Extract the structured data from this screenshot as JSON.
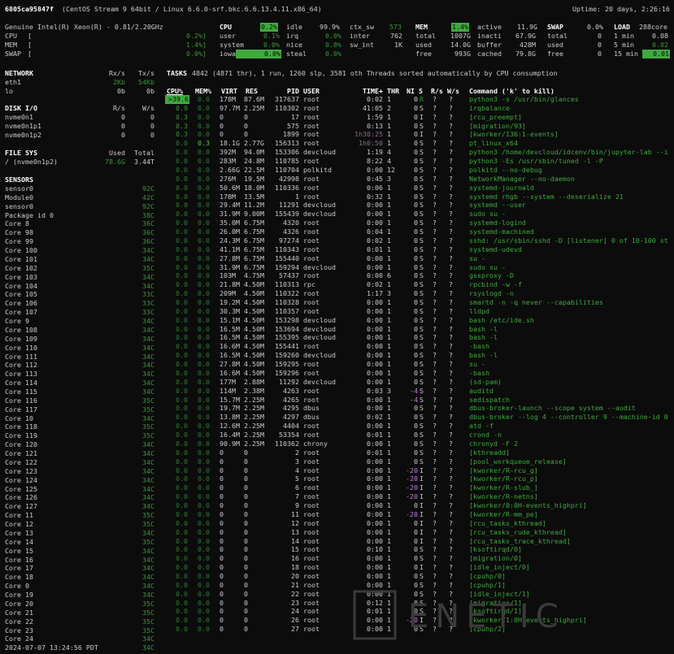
{
  "header": {
    "hostname": "6805ca95847f",
    "os": "(CentOS Stream 9 64bit / Linux 6.6.0-srf.bkc.6.6.13.4.11.x86_64)",
    "uptime": "Uptime: 20 days, 2:26:16"
  },
  "cpu_panel": {
    "model": "Genuine Intel(R) Xeon(R) - 0.81/2.20GHz",
    "bars": [
      {
        "label": "CPU",
        "bar": "[",
        "value": "0.2%]"
      },
      {
        "label": "MEM",
        "bar": "[",
        "value": "1.4%]"
      },
      {
        "label": "SWAP",
        "bar": "[",
        "value": "0.0%]"
      }
    ]
  },
  "cpu": {
    "title": "CPU",
    "total": "0.2%",
    "rows": [
      [
        "user",
        "0.1%",
        "irq",
        "0.0%",
        "inter",
        "762"
      ],
      [
        "system",
        "0.0%",
        "nice",
        "0.0%",
        "sw_int",
        "1K"
      ],
      [
        "iowait",
        "0.0%",
        "steal",
        "0.0%",
        "",
        ""
      ]
    ],
    "idle_label": "idle",
    "idle": "99.9%",
    "ctx_label": "ctx_sw",
    "ctx": "573"
  },
  "mem": {
    "title": "MEM",
    "total": "1.4%",
    "rows": [
      [
        "total",
        "1007G",
        "inacti",
        "67.9G"
      ],
      [
        "used",
        "14.0G",
        "buffer",
        "428M"
      ],
      [
        "free",
        "993G",
        "cached",
        "79.8G"
      ]
    ],
    "active_label": "active",
    "active": "11.9G"
  },
  "swap": {
    "title": "SWAP",
    "total": "0.0%",
    "rows": [
      [
        "total",
        "0"
      ],
      [
        "used",
        "0"
      ],
      [
        "free",
        "0"
      ]
    ]
  },
  "load": {
    "title": "LOAD",
    "cores": "288core",
    "rows": [
      [
        "1 min",
        "0.08"
      ],
      [
        "5 min",
        "0.02"
      ],
      [
        "15 min",
        "0.01"
      ]
    ]
  },
  "network": {
    "title": "NETWORK",
    "rx": "Rx/s",
    "tx": "Tx/s",
    "rows": [
      [
        "eth1",
        "2Kb",
        "54Kb"
      ],
      [
        "lo",
        "0b",
        "0b"
      ]
    ]
  },
  "disk": {
    "title": "DISK I/O",
    "r": "R/s",
    "w": "W/s",
    "rows": [
      [
        "nvme0n1",
        "0",
        "0"
      ],
      [
        "nvme0n1p1",
        "0",
        "0"
      ],
      [
        "nvme0n1p2",
        "0",
        "0"
      ]
    ]
  },
  "fs": {
    "title": "FILE SYS",
    "used": "Used",
    "total": "Total",
    "rows": [
      [
        "/ (nvme0n1p2)",
        "78.6G",
        "3.44T"
      ]
    ]
  },
  "sensors": {
    "title": "SENSORS",
    "rows": [
      [
        "sensor0",
        "92C"
      ],
      [
        "Module0",
        "42C"
      ],
      [
        "sensor0",
        "92C"
      ],
      [
        "Package id 0",
        "38C"
      ],
      [
        "Core 8",
        "36C"
      ],
      [
        "Core 98",
        "36C"
      ],
      [
        "Core 99",
        "36C"
      ],
      [
        "Core 100",
        "34C"
      ],
      [
        "Core 101",
        "34C"
      ],
      [
        "Core 102",
        "35C"
      ],
      [
        "Core 103",
        "34C"
      ],
      [
        "Core 104",
        "34C"
      ],
      [
        "Core 105",
        "33C"
      ],
      [
        "Core 106",
        "33C"
      ],
      [
        "Core 107",
        "33C"
      ],
      [
        "Core 9",
        "34C"
      ],
      [
        "Core 108",
        "34C"
      ],
      [
        "Core 109",
        "34C"
      ],
      [
        "Core 110",
        "34C"
      ],
      [
        "Core 111",
        "34C"
      ],
      [
        "Core 112",
        "34C"
      ],
      [
        "Core 113",
        "34C"
      ],
      [
        "Core 114",
        "34C"
      ],
      [
        "Core 115",
        "34C"
      ],
      [
        "Core 116",
        "35C"
      ],
      [
        "Core 117",
        "35C"
      ],
      [
        "Core 10",
        "34C"
      ],
      [
        "Core 118",
        "35C"
      ],
      [
        "Core 119",
        "35C"
      ],
      [
        "Core 120",
        "34C"
      ],
      [
        "Core 121",
        "34C"
      ],
      [
        "Core 122",
        "34C"
      ],
      [
        "Core 123",
        "34C"
      ],
      [
        "Core 124",
        "34C"
      ],
      [
        "Core 125",
        "34C"
      ],
      [
        "Core 126",
        "34C"
      ],
      [
        "Core 127",
        "34C"
      ],
      [
        "Core 11",
        "35C"
      ],
      [
        "Core 12",
        "35C"
      ],
      [
        "Core 13",
        "34C"
      ],
      [
        "Core 14",
        "35C"
      ],
      [
        "Core 15",
        "34C"
      ],
      [
        "Core 16",
        "34C"
      ],
      [
        "Core 17",
        "34C"
      ],
      [
        "Core 18",
        "34C"
      ],
      [
        "Core 0",
        "34C"
      ],
      [
        "Core 19",
        "34C"
      ],
      [
        "Core 20",
        "35C"
      ],
      [
        "Core 21",
        "35C"
      ],
      [
        "Core 22",
        "35C"
      ],
      [
        "Core 23",
        "35C"
      ],
      [
        "Core 24",
        "34C"
      ]
    ]
  },
  "footer": {
    "datetime": "2024-07-07 13:24:56 PDT",
    "last": "34C"
  },
  "tasks": {
    "label": "TASKS",
    "summary": "4842 (4871 thr), 1 run, 1260 slp, 3581 oth Threads sorted automatically by CPU consumption"
  },
  "proc_headers": [
    "CPU%",
    "MEM%",
    "VIRT",
    "RES",
    "PID",
    "USER",
    "TIME+",
    "THR",
    "NI",
    "S",
    "R/s",
    "W/s",
    "Command ('k' to kill)"
  ],
  "procs": [
    [
      ">39.6",
      "0.0",
      "178M",
      "87.6M",
      "317637",
      "root",
      "0:02",
      "1",
      "0",
      "R",
      "?",
      "?",
      "python3 -s /usr/bin/glances"
    ],
    [
      "0.9",
      "0.0",
      "97.7M",
      "2.25M",
      "110302",
      "root",
      "41:05",
      "2",
      "0",
      "S",
      "?",
      "?",
      "irqbalance"
    ],
    [
      "0.3",
      "0.0",
      "0",
      "0",
      "17",
      "root",
      "1:59",
      "1",
      "0",
      "I",
      "?",
      "?",
      "[rcu_preempt]"
    ],
    [
      "0.3",
      "0.0",
      "0",
      "0",
      "575",
      "root",
      "0:13",
      "1",
      "0",
      "S",
      "?",
      "?",
      "[migration/93]"
    ],
    [
      "0.3",
      "0.0",
      "0",
      "0",
      "1899",
      "root",
      "1h30:25",
      "1",
      "0",
      "I",
      "?",
      "?",
      "[kworker/136:1-events]"
    ],
    [
      "0.0",
      "0.3",
      "18.1G",
      "2.77G",
      "156313",
      "root",
      "1h0:50",
      "1",
      "0",
      "S",
      "?",
      "?",
      "pt_linux_x64"
    ],
    [
      "0.0",
      "0.0",
      "392M",
      "94.0M",
      "153306",
      "devcloud",
      "1:19",
      "4",
      "0",
      "S",
      "?",
      "?",
      "python3 /home/devcloud/idcenv/bin/jupyter-lab --i"
    ],
    [
      "0.0",
      "0.0",
      "283M",
      "24.8M",
      "110785",
      "root",
      "8:22",
      "4",
      "0",
      "S",
      "?",
      "?",
      "python3 -Es /usr/sbin/tuned -l -P"
    ],
    [
      "0.0",
      "0.0",
      "2.66G",
      "22.5M",
      "110704",
      "polkitd",
      "0:00",
      "12",
      "0",
      "S",
      "?",
      "?",
      "polkitd --no-debug"
    ],
    [
      "0.0",
      "0.0",
      "276M",
      "19.5M",
      "42998",
      "root",
      "0:45",
      "3",
      "0",
      "S",
      "?",
      "?",
      "NetworkManager --no-daemon"
    ],
    [
      "0.0",
      "0.0",
      "50.6M",
      "18.0M",
      "110336",
      "root",
      "0:06",
      "1",
      "0",
      "S",
      "?",
      "?",
      "systemd-journald"
    ],
    [
      "0.0",
      "0.0",
      "178M",
      "13.5M",
      "1",
      "root",
      "0:32",
      "1",
      "0",
      "S",
      "?",
      "?",
      "systemd rhgb --system --deserialize 21"
    ],
    [
      "0.0",
      "0.0",
      "29.4M",
      "11.2M",
      "11291",
      "devcloud",
      "0:00",
      "1",
      "0",
      "S",
      "?",
      "?",
      "systemd --user"
    ],
    [
      "0.0",
      "0.0",
      "31.9M",
      "9.00M",
      "155439",
      "devcloud",
      "0:00",
      "1",
      "0",
      "S",
      "?",
      "?",
      "sudo su -"
    ],
    [
      "0.0",
      "0.0",
      "35.0M",
      "6.75M",
      "4320",
      "root",
      "0:00",
      "1",
      "0",
      "S",
      "?",
      "?",
      "systemd-logind"
    ],
    [
      "0.0",
      "0.0",
      "26.0M",
      "6.75M",
      "4326",
      "root",
      "0:04",
      "1",
      "0",
      "S",
      "?",
      "?",
      "systemd-machined"
    ],
    [
      "0.0",
      "0.0",
      "24.3M",
      "6.75M",
      "97274",
      "root",
      "0:02",
      "1",
      "0",
      "S",
      "?",
      "?",
      "sshd: /usr/sbin/sshd -D [listener] 0 of 10-100 st"
    ],
    [
      "0.0",
      "0.0",
      "41.1M",
      "6.75M",
      "110343",
      "root",
      "0:01",
      "1",
      "0",
      "S",
      "?",
      "?",
      "systemd-udevd"
    ],
    [
      "0.0",
      "0.0",
      "27.8M",
      "6.75M",
      "155440",
      "root",
      "0:00",
      "1",
      "0",
      "S",
      "?",
      "?",
      "su -"
    ],
    [
      "0.0",
      "0.0",
      "31.9M",
      "6.75M",
      "159294",
      "devcloud",
      "0:00",
      "1",
      "0",
      "S",
      "?",
      "?",
      "sudo su -"
    ],
    [
      "0.0",
      "0.0",
      "103M",
      "4.75M",
      "57437",
      "root",
      "0:00",
      "6",
      "0",
      "S",
      "?",
      "?",
      "gssproxy -D"
    ],
    [
      "0.0",
      "0.0",
      "21.8M",
      "4.50M",
      "110313",
      "rpc",
      "0:02",
      "1",
      "0",
      "S",
      "?",
      "?",
      "rpcbind -w -f"
    ],
    [
      "0.0",
      "0.0",
      "209M",
      "4.50M",
      "110322",
      "root",
      "1:17",
      "3",
      "0",
      "S",
      "?",
      "?",
      "rsyslogd -n"
    ],
    [
      "0.0",
      "0.0",
      "19.2M",
      "4.50M",
      "110328",
      "root",
      "0:00",
      "1",
      "0",
      "S",
      "?",
      "?",
      "smartd -n -q never --capabilities"
    ],
    [
      "0.0",
      "0.0",
      "30.3M",
      "4.50M",
      "110357",
      "root",
      "0:00",
      "1",
      "0",
      "S",
      "?",
      "?",
      "lldpd"
    ],
    [
      "0.0",
      "0.0",
      "15.1M",
      "4.50M",
      "153298",
      "devcloud",
      "0:00",
      "1",
      "0",
      "S",
      "?",
      "?",
      "bash /etc/ide.sh"
    ],
    [
      "0.0",
      "0.0",
      "16.5M",
      "4.50M",
      "153694",
      "devcloud",
      "0:00",
      "1",
      "0",
      "S",
      "?",
      "?",
      "bash -l"
    ],
    [
      "0.0",
      "0.0",
      "16.5M",
      "4.50M",
      "155395",
      "devcloud",
      "0:00",
      "1",
      "0",
      "S",
      "?",
      "?",
      "bash -l"
    ],
    [
      "0.0",
      "0.0",
      "16.6M",
      "4.50M",
      "155441",
      "root",
      "0:00",
      "1",
      "0",
      "S",
      "?",
      "?",
      "-bash"
    ],
    [
      "0.0",
      "0.0",
      "16.5M",
      "4.50M",
      "159260",
      "devcloud",
      "0:00",
      "1",
      "0",
      "S",
      "?",
      "?",
      "bash -l"
    ],
    [
      "0.0",
      "0.0",
      "27.8M",
      "4.50M",
      "159295",
      "root",
      "0:00",
      "1",
      "0",
      "S",
      "?",
      "?",
      "su -"
    ],
    [
      "0.0",
      "0.0",
      "16.6M",
      "4.50M",
      "159296",
      "root",
      "0:00",
      "1",
      "0",
      "S",
      "?",
      "?",
      "-bash"
    ],
    [
      "0.0",
      "0.0",
      "177M",
      "2.88M",
      "11292",
      "devcloud",
      "0:00",
      "1",
      "0",
      "S",
      "?",
      "?",
      "(sd-pam)"
    ],
    [
      "0.0",
      "0.0",
      "114M",
      "2.38M",
      "4263",
      "root",
      "0:03",
      "3",
      "-4",
      "S",
      "?",
      "?",
      "auditd"
    ],
    [
      "0.0",
      "0.0",
      "15.7M",
      "2.25M",
      "4265",
      "root",
      "0:00",
      "1",
      "-4",
      "S",
      "?",
      "?",
      "sedispatch"
    ],
    [
      "0.0",
      "0.0",
      "19.7M",
      "2.25M",
      "4295",
      "dbus",
      "0:00",
      "1",
      "0",
      "S",
      "?",
      "?",
      "dbus-broker-launch --scope system --audit"
    ],
    [
      "0.0",
      "0.0",
      "13.8M",
      "2.25M",
      "4297",
      "dbus",
      "0:02",
      "1",
      "0",
      "S",
      "?",
      "?",
      "dbus-broker --log 4 --controller 9 --machine-id 0"
    ],
    [
      "0.0",
      "0.0",
      "12.6M",
      "2.25M",
      "4404",
      "root",
      "0:00",
      "1",
      "0",
      "S",
      "?",
      "?",
      "atd -f"
    ],
    [
      "0.0",
      "0.0",
      "16.4M",
      "2.25M",
      "53354",
      "root",
      "0:01",
      "1",
      "0",
      "S",
      "?",
      "?",
      "crond -n"
    ],
    [
      "0.0",
      "0.0",
      "90.9M",
      "2.25M",
      "110362",
      "chrony",
      "0:00",
      "1",
      "0",
      "S",
      "?",
      "?",
      "chronyd -F 2"
    ],
    [
      "0.0",
      "0.0",
      "0",
      "0",
      "2",
      "root",
      "0:01",
      "1",
      "0",
      "S",
      "?",
      "?",
      "[kthreadd]"
    ],
    [
      "0.0",
      "0.0",
      "0",
      "0",
      "3",
      "root",
      "0:00",
      "1",
      "0",
      "S",
      "?",
      "?",
      "[pool_workqueue_release]"
    ],
    [
      "0.0",
      "0.0",
      "0",
      "0",
      "4",
      "root",
      "0:00",
      "1",
      "-20",
      "I",
      "?",
      "?",
      "[kworker/R-rcu_g]"
    ],
    [
      "0.0",
      "0.0",
      "0",
      "0",
      "5",
      "root",
      "0:00",
      "1",
      "-20",
      "I",
      "?",
      "?",
      "[kworker/R-rcu_p]"
    ],
    [
      "0.0",
      "0.0",
      "0",
      "0",
      "6",
      "root",
      "0:00",
      "1",
      "-20",
      "I",
      "?",
      "?",
      "[kworker/R-slub_]"
    ],
    [
      "0.0",
      "0.0",
      "0",
      "0",
      "7",
      "root",
      "0:00",
      "1",
      "-20",
      "I",
      "?",
      "?",
      "[kworker/R-netns]"
    ],
    [
      "0.0",
      "0.0",
      "0",
      "0",
      "9",
      "root",
      "0:00",
      "1",
      "0",
      "I",
      "?",
      "?",
      "[kworker/0:0H-events_highpri]"
    ],
    [
      "0.0",
      "0.0",
      "0",
      "0",
      "11",
      "root",
      "0:00",
      "1",
      "-20",
      "I",
      "?",
      "?",
      "[kworker/R-mm_pe]"
    ],
    [
      "0.0",
      "0.0",
      "0",
      "0",
      "12",
      "root",
      "0:00",
      "1",
      "0",
      "I",
      "?",
      "?",
      "[rcu_tasks_kthread]"
    ],
    [
      "0.0",
      "0.0",
      "0",
      "0",
      "13",
      "root",
      "0:00",
      "1",
      "0",
      "I",
      "?",
      "?",
      "[rcu_tasks_rude_kthread]"
    ],
    [
      "0.0",
      "0.0",
      "0",
      "0",
      "14",
      "root",
      "0:00",
      "1",
      "0",
      "I",
      "?",
      "?",
      "[rcu_tasks_trace_kthread]"
    ],
    [
      "0.0",
      "0.0",
      "0",
      "0",
      "15",
      "root",
      "0:10",
      "1",
      "0",
      "S",
      "?",
      "?",
      "[ksoftirqd/0]"
    ],
    [
      "0.0",
      "0.0",
      "0",
      "0",
      "16",
      "root",
      "0:00",
      "1",
      "0",
      "S",
      "?",
      "?",
      "[migration/0]"
    ],
    [
      "0.0",
      "0.0",
      "0",
      "0",
      "18",
      "root",
      "0:00",
      "1",
      "0",
      "I",
      "?",
      "?",
      "[idle_inject/0]"
    ],
    [
      "0.0",
      "0.0",
      "0",
      "0",
      "20",
      "root",
      "0:00",
      "1",
      "0",
      "S",
      "?",
      "?",
      "[cpuhp/0]"
    ],
    [
      "0.0",
      "0.0",
      "0",
      "0",
      "21",
      "root",
      "0:00",
      "1",
      "0",
      "S",
      "?",
      "?",
      "[cpuhp/1]"
    ],
    [
      "0.0",
      "0.0",
      "0",
      "0",
      "22",
      "root",
      "0:00",
      "1",
      "0",
      "S",
      "?",
      "?",
      "[idle_inject/1]"
    ],
    [
      "0.0",
      "0.0",
      "0",
      "0",
      "23",
      "root",
      "0:12",
      "1",
      "0",
      "S",
      "?",
      "?",
      "[migration/1]"
    ],
    [
      "0.0",
      "0.0",
      "0",
      "0",
      "24",
      "root",
      "0:01",
      "1",
      "0",
      "S",
      "?",
      "?",
      "[ksoftirqd/1]"
    ],
    [
      "0.0",
      "0.0",
      "0",
      "0",
      "26",
      "root",
      "0:00",
      "1",
      "-20",
      "I",
      "?",
      "?",
      "[kworker/1:0H-events_highpri]"
    ],
    [
      "0.0",
      "0.0",
      "0",
      "0",
      "27",
      "root",
      "0:00",
      "1",
      "0",
      "S",
      "?",
      "?",
      "[cpuhp/2]"
    ]
  ],
  "watermark": "ELCHAPUZASINFORMATICO"
}
